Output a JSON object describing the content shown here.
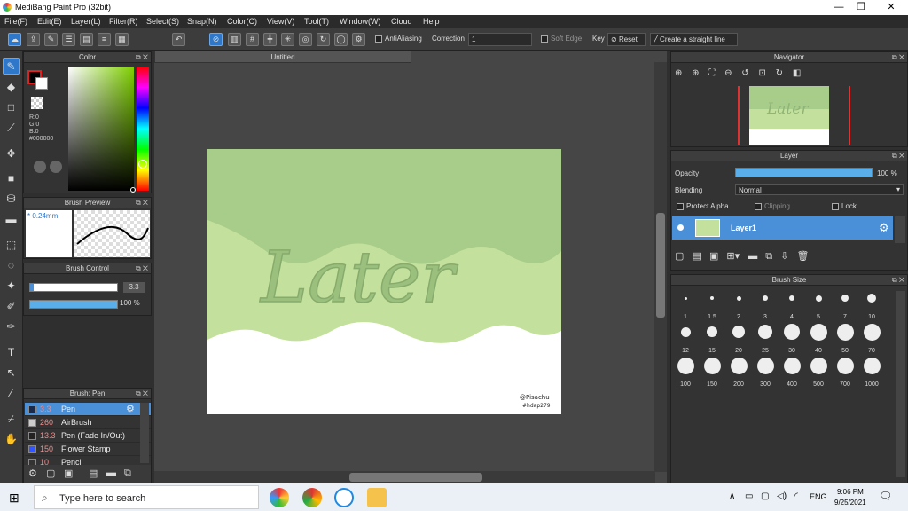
{
  "window": {
    "title": "MediBang Paint Pro (32bit)",
    "minimize": "—",
    "restore": "❐",
    "close": "✕"
  },
  "menu": [
    "File(F)",
    "Edit(E)",
    "Layer(L)",
    "Filter(R)",
    "Select(S)",
    "Snap(N)",
    "Color(C)",
    "View(V)",
    "Tool(T)",
    "Window(W)",
    "Cloud",
    "Help"
  ],
  "toolbar": {
    "antialiasing": "AntiAliasing",
    "correction_label": "Correction",
    "correction_value": "1",
    "soft_edge": "Soft Edge",
    "key_label": "Key",
    "reset": "Reset",
    "straight_line": "Create a straight line"
  },
  "color_panel": {
    "title": "Color",
    "r": "R:0",
    "g": "G:0",
    "b": "B:0",
    "hex": "#000000",
    "current_color": "#000000"
  },
  "brush_preview": {
    "title": "Brush Preview",
    "size": "* 0.24mm"
  },
  "brush_control": {
    "title": "Brush Control",
    "size_value": "3.3",
    "opacity_value": "100 %",
    "opacity_fraction": 1.0
  },
  "brush_list": {
    "title": "Brush: Pen",
    "items": [
      {
        "size": "3.3",
        "name": "Pen",
        "color": "#1a2a4a",
        "selected": true
      },
      {
        "size": "260",
        "name": "AirBrush",
        "color": "#cccccc",
        "selected": false
      },
      {
        "size": "13.3",
        "name": "Pen (Fade In/Out)",
        "color": "#222222",
        "selected": false
      },
      {
        "size": "150",
        "name": "Flower Stamp",
        "color": "#3355ff",
        "selected": false
      },
      {
        "size": "10",
        "name": "Pencil",
        "color": "#333333",
        "selected": false
      }
    ]
  },
  "canvas": {
    "doc_title": "Untitled",
    "artwork_text": "Later",
    "signature_line1": "@Pisachu",
    "signature_line2": "#hdap279",
    "bg_top": "#a8cd8a",
    "bg_mid": "#c3e19c",
    "text_color": "#9bc07e"
  },
  "navigator": {
    "title": "Navigator"
  },
  "layer_panel": {
    "title": "Layer",
    "opacity_label": "Opacity",
    "opacity_value": "100 %",
    "opacity_fraction": 1.0,
    "blending_label": "Blending",
    "blending_value": "Normal",
    "protect_alpha": "Protect Alpha",
    "clipping": "Clipping",
    "lock": "Lock",
    "layers": [
      {
        "name": "Layer1",
        "selected": true
      }
    ]
  },
  "brush_size": {
    "title": "Brush Size",
    "sizes": [
      "1",
      "1.5",
      "2",
      "3",
      "4",
      "5",
      "7",
      "10",
      "12",
      "15",
      "20",
      "25",
      "30",
      "40",
      "50",
      "70",
      "100",
      "150",
      "200",
      "300",
      "400",
      "500",
      "700",
      "1000"
    ]
  },
  "taskbar": {
    "search_placeholder": "Type here to search",
    "time": "9:06 PM",
    "date": "9/25/2021",
    "lang": "ENG"
  }
}
